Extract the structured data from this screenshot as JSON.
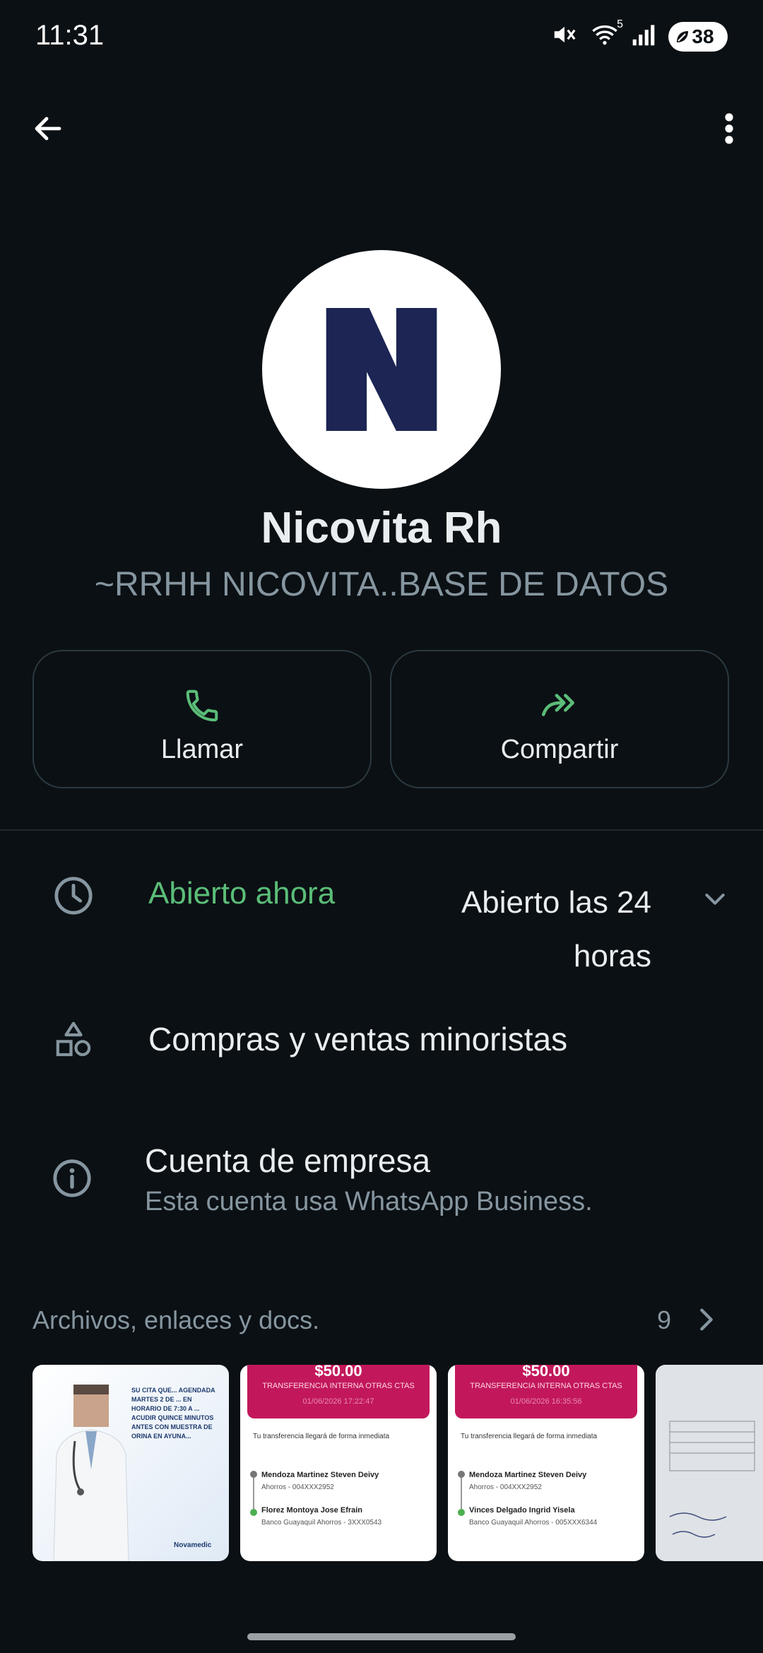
{
  "status_bar": {
    "time": "11:31",
    "battery": "38",
    "network": "5"
  },
  "contact": {
    "initial": "N",
    "name": "Nicovita Rh",
    "subname": "~RRHH NICOVITA..BASE DE DATOS"
  },
  "actions": {
    "call_label": "Llamar",
    "share_label": "Compartir"
  },
  "info": {
    "hours_status": "Abierto ahora",
    "hours_detail": "Abierto las 24 horas",
    "category": "Compras y ventas minoristas",
    "business_title": "Cuenta de empresa",
    "business_subtitle": "Esta cuenta usa WhatsApp Business."
  },
  "media": {
    "title": "Archivos, enlaces y docs.",
    "count": "9",
    "items": [
      {
        "type": "image",
        "text": "SU CITA QUE... AGENDADA MARTES 2 DE ... EN HORARIO DE 7:30 A ... ACUDIR QUINCE MINUTOS ANTES CON MUESTRA DE ORINA EN AYUNA...",
        "logo": "Novamedic"
      },
      {
        "type": "transfer",
        "amount": "$50.00",
        "label": "TRANSFERENCIA INTERNA OTRAS CTAS",
        "date": "01/06/2026 17:22:47",
        "note": "Tu transferencia llegará de forma inmediata",
        "from_name": "Mendoza Martinez Steven Deivy",
        "from_account": "Ahorros - 004XXX2952",
        "to_name": "Florez Montoya Jose Efrain",
        "to_account": "Banco Guayaquil Ahorros - 3XXX0543"
      },
      {
        "type": "transfer",
        "amount": "$50.00",
        "label": "TRANSFERENCIA INTERNA OTRAS CTAS",
        "date": "01/06/2026 16:35:56",
        "note": "Tu transferencia llegará de forma inmediata",
        "from_name": "Mendoza Martinez Steven Deivy",
        "from_account": "Ahorros - 004XXX2952",
        "to_name": "Vinces Delgado Ingrid Yisela",
        "to_account": "Banco Guayaquil Ahorros - 005XXX6344"
      },
      {
        "type": "document"
      }
    ]
  },
  "colors": {
    "background": "#0b1014",
    "accent_green": "#5bbd78",
    "muted": "#8696a0"
  },
  "icons": [
    "back-arrow-icon",
    "more-vert-icon",
    "phone-icon",
    "share-forward-icon",
    "clock-icon",
    "chevron-down-icon",
    "shapes-icon",
    "info-icon",
    "chevron-right-icon"
  ]
}
